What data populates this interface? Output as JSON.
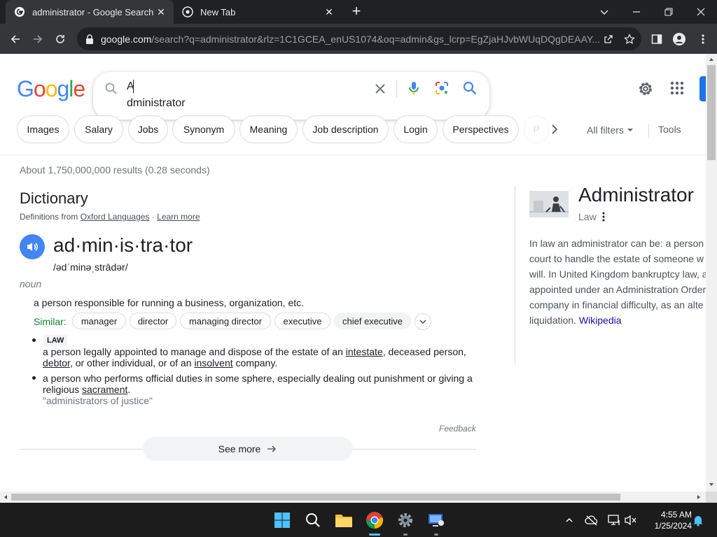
{
  "browser": {
    "tabs": [
      {
        "title": "administrator - Google Search",
        "active": true
      },
      {
        "title": "New Tab",
        "active": false
      }
    ],
    "url_host": "google.com",
    "url_rest": "/search?q=administrator&rlz=1C1GCEA_enUS1074&oq=admin&gs_lcrp=EgZjaHJvbWUqDQgDEAAY..."
  },
  "google": {
    "logo": {
      "letters": [
        "G",
        "o",
        "o",
        "g",
        "l",
        "e"
      ],
      "colors": [
        "#4285f4",
        "#ea4335",
        "#fbbc05",
        "#4285f4",
        "#34a853",
        "#ea4335"
      ]
    },
    "search": {
      "line1": "A",
      "line2": "dministrator"
    },
    "chips": [
      "Images",
      "Salary",
      "Jobs",
      "Synonym",
      "Meaning",
      "Job description",
      "Login",
      "Perspectives",
      "P"
    ],
    "all_filters": "All filters",
    "tools": "Tools",
    "stats": "About 1,750,000,000 results (0.28 seconds)"
  },
  "dictionary": {
    "title": "Dictionary",
    "source_prefix": "Definitions from",
    "source_link": "Oxford Languages",
    "separator": "·",
    "learn_more": "Learn more",
    "word": "ad·min·is·tra·tor",
    "phonetic": "/ədˈminəˌstrādər/",
    "pos": "noun",
    "definition1": "a person responsible for running a business, organization, etc.",
    "similar_label": "Similar:",
    "synonyms": [
      "manager",
      "director",
      "managing director",
      "executive",
      "chief executive"
    ],
    "law_label": "LAW",
    "definition2": {
      "t1": "a person legally appointed to manage and dispose of the estate of an ",
      "l1": "intestate",
      "t2": ", deceased person, ",
      "l2": "debtor",
      "t3": ", or other individual, or of an ",
      "l3": "insolvent",
      "t4": " company."
    },
    "definition3": {
      "t1": "a person who performs official duties in some sphere, especially dealing out punishment or giving a religious ",
      "l1": "sacrament",
      "t2": "."
    },
    "example": "\"administrators of justice\"",
    "feedback": "Feedback",
    "see_more": "See more"
  },
  "knowledge_panel": {
    "title": "Administrator",
    "subtitle": "Law",
    "description_lines": [
      "In law an administrator can be: a person",
      "court to handle the estate of someone w",
      "will. In United Kingdom bankruptcy law, a",
      "appointed under an Administration Order",
      "company in financial difficulty, as an alte"
    ],
    "description_last": "liquidation. ",
    "wikipedia": "Wikipedia"
  },
  "taskbar": {
    "time": "4:55 AM",
    "date": "1/25/2024"
  }
}
